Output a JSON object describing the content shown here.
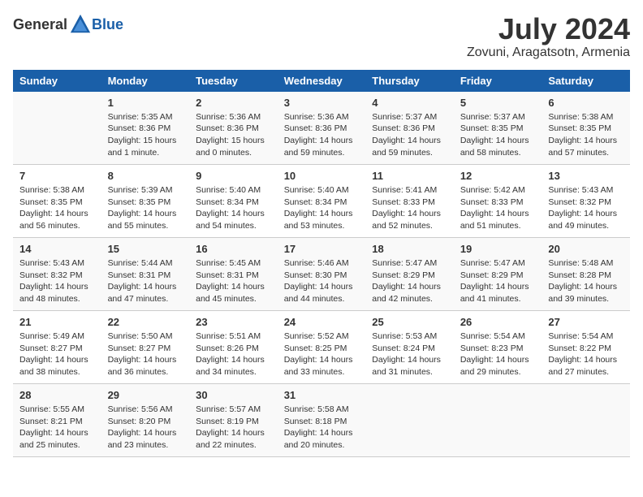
{
  "header": {
    "logo_general": "General",
    "logo_blue": "Blue",
    "month": "July 2024",
    "location": "Zovuni, Aragatsotn, Armenia"
  },
  "days_of_week": [
    "Sunday",
    "Monday",
    "Tuesday",
    "Wednesday",
    "Thursday",
    "Friday",
    "Saturday"
  ],
  "weeks": [
    [
      {
        "day": "",
        "info": ""
      },
      {
        "day": "1",
        "info": "Sunrise: 5:35 AM\nSunset: 8:36 PM\nDaylight: 15 hours\nand 1 minute."
      },
      {
        "day": "2",
        "info": "Sunrise: 5:36 AM\nSunset: 8:36 PM\nDaylight: 15 hours\nand 0 minutes."
      },
      {
        "day": "3",
        "info": "Sunrise: 5:36 AM\nSunset: 8:36 PM\nDaylight: 14 hours\nand 59 minutes."
      },
      {
        "day": "4",
        "info": "Sunrise: 5:37 AM\nSunset: 8:36 PM\nDaylight: 14 hours\nand 59 minutes."
      },
      {
        "day": "5",
        "info": "Sunrise: 5:37 AM\nSunset: 8:35 PM\nDaylight: 14 hours\nand 58 minutes."
      },
      {
        "day": "6",
        "info": "Sunrise: 5:38 AM\nSunset: 8:35 PM\nDaylight: 14 hours\nand 57 minutes."
      }
    ],
    [
      {
        "day": "7",
        "info": "Sunrise: 5:38 AM\nSunset: 8:35 PM\nDaylight: 14 hours\nand 56 minutes."
      },
      {
        "day": "8",
        "info": "Sunrise: 5:39 AM\nSunset: 8:35 PM\nDaylight: 14 hours\nand 55 minutes."
      },
      {
        "day": "9",
        "info": "Sunrise: 5:40 AM\nSunset: 8:34 PM\nDaylight: 14 hours\nand 54 minutes."
      },
      {
        "day": "10",
        "info": "Sunrise: 5:40 AM\nSunset: 8:34 PM\nDaylight: 14 hours\nand 53 minutes."
      },
      {
        "day": "11",
        "info": "Sunrise: 5:41 AM\nSunset: 8:33 PM\nDaylight: 14 hours\nand 52 minutes."
      },
      {
        "day": "12",
        "info": "Sunrise: 5:42 AM\nSunset: 8:33 PM\nDaylight: 14 hours\nand 51 minutes."
      },
      {
        "day": "13",
        "info": "Sunrise: 5:43 AM\nSunset: 8:32 PM\nDaylight: 14 hours\nand 49 minutes."
      }
    ],
    [
      {
        "day": "14",
        "info": "Sunrise: 5:43 AM\nSunset: 8:32 PM\nDaylight: 14 hours\nand 48 minutes."
      },
      {
        "day": "15",
        "info": "Sunrise: 5:44 AM\nSunset: 8:31 PM\nDaylight: 14 hours\nand 47 minutes."
      },
      {
        "day": "16",
        "info": "Sunrise: 5:45 AM\nSunset: 8:31 PM\nDaylight: 14 hours\nand 45 minutes."
      },
      {
        "day": "17",
        "info": "Sunrise: 5:46 AM\nSunset: 8:30 PM\nDaylight: 14 hours\nand 44 minutes."
      },
      {
        "day": "18",
        "info": "Sunrise: 5:47 AM\nSunset: 8:29 PM\nDaylight: 14 hours\nand 42 minutes."
      },
      {
        "day": "19",
        "info": "Sunrise: 5:47 AM\nSunset: 8:29 PM\nDaylight: 14 hours\nand 41 minutes."
      },
      {
        "day": "20",
        "info": "Sunrise: 5:48 AM\nSunset: 8:28 PM\nDaylight: 14 hours\nand 39 minutes."
      }
    ],
    [
      {
        "day": "21",
        "info": "Sunrise: 5:49 AM\nSunset: 8:27 PM\nDaylight: 14 hours\nand 38 minutes."
      },
      {
        "day": "22",
        "info": "Sunrise: 5:50 AM\nSunset: 8:27 PM\nDaylight: 14 hours\nand 36 minutes."
      },
      {
        "day": "23",
        "info": "Sunrise: 5:51 AM\nSunset: 8:26 PM\nDaylight: 14 hours\nand 34 minutes."
      },
      {
        "day": "24",
        "info": "Sunrise: 5:52 AM\nSunset: 8:25 PM\nDaylight: 14 hours\nand 33 minutes."
      },
      {
        "day": "25",
        "info": "Sunrise: 5:53 AM\nSunset: 8:24 PM\nDaylight: 14 hours\nand 31 minutes."
      },
      {
        "day": "26",
        "info": "Sunrise: 5:54 AM\nSunset: 8:23 PM\nDaylight: 14 hours\nand 29 minutes."
      },
      {
        "day": "27",
        "info": "Sunrise: 5:54 AM\nSunset: 8:22 PM\nDaylight: 14 hours\nand 27 minutes."
      }
    ],
    [
      {
        "day": "28",
        "info": "Sunrise: 5:55 AM\nSunset: 8:21 PM\nDaylight: 14 hours\nand 25 minutes."
      },
      {
        "day": "29",
        "info": "Sunrise: 5:56 AM\nSunset: 8:20 PM\nDaylight: 14 hours\nand 23 minutes."
      },
      {
        "day": "30",
        "info": "Sunrise: 5:57 AM\nSunset: 8:19 PM\nDaylight: 14 hours\nand 22 minutes."
      },
      {
        "day": "31",
        "info": "Sunrise: 5:58 AM\nSunset: 8:18 PM\nDaylight: 14 hours\nand 20 minutes."
      },
      {
        "day": "",
        "info": ""
      },
      {
        "day": "",
        "info": ""
      },
      {
        "day": "",
        "info": ""
      }
    ]
  ]
}
